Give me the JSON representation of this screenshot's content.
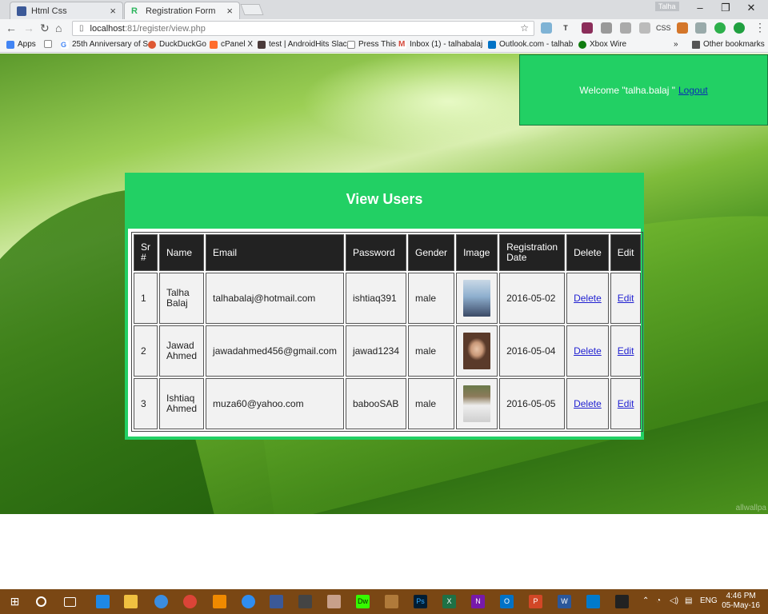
{
  "browser": {
    "tabs": [
      {
        "label": "Html Css",
        "favicon": "facebook-icon",
        "active": false
      },
      {
        "label": "Registration Form",
        "favicon": "r-favicon-icon",
        "active": true
      }
    ],
    "profile_name": "Talha",
    "url_host": "localhost",
    "url_path": ":81/register/view.php",
    "bookmarks": [
      {
        "label": "Apps",
        "icon": "apps-icon"
      },
      {
        "label": "",
        "icon": "document-icon"
      },
      {
        "label": "25th Anniversary of S",
        "icon": "google-icon"
      },
      {
        "label": "DuckDuckGo",
        "icon": "duckduckgo-icon"
      },
      {
        "label": "cPanel X",
        "icon": "cpanel-icon"
      },
      {
        "label": "test | AndroidHits Slac",
        "icon": "slack-icon"
      },
      {
        "label": "Press This",
        "icon": "document-icon"
      },
      {
        "label": "Inbox (1) - talhabalaj",
        "icon": "gmail-icon"
      },
      {
        "label": "Outlook.com - talhab",
        "icon": "outlook-icon"
      },
      {
        "label": "Xbox Wire",
        "icon": "xbox-icon"
      }
    ],
    "other_bookmarks": "Other bookmarks",
    "overflow": "»",
    "ext_css_label": "CSS"
  },
  "page": {
    "welcome_text": "Welcome \"talha.balaj \"",
    "logout_label": "Logout",
    "title": "View Users",
    "watermark": "allwallpa",
    "columns": [
      "Sr #",
      "Name",
      "Email",
      "Password",
      "Gender",
      "Image",
      "Registration Date",
      "Delete",
      "Edit"
    ],
    "rows": [
      {
        "sr": "1",
        "name": "Talha Balaj",
        "email": "talhabalaj@hotmail.com",
        "password": "ishtiaq391",
        "gender": "male",
        "date": "2016-05-02",
        "delete": "Delete",
        "edit": "Edit"
      },
      {
        "sr": "2",
        "name": "Jawad Ahmed",
        "email": "jawadahmed456@gmail.com",
        "password": "jawad1234",
        "gender": "male",
        "date": "2016-05-04",
        "delete": "Delete",
        "edit": "Edit"
      },
      {
        "sr": "3",
        "name": "Ishtiaq Ahmed",
        "email": "muza60@yahoo.com",
        "password": "babooSAB",
        "gender": "male",
        "date": "2016-05-05",
        "delete": "Delete",
        "edit": "Edit"
      }
    ]
  },
  "taskbar": {
    "language": "ENG",
    "time": "4:46 PM",
    "date": "05-May-16",
    "apps": [
      "windows-icon",
      "search-icon",
      "task-view-icon",
      "edge-icon",
      "file-explorer-icon",
      "ie-icon",
      "chrome-icon",
      "vlc-icon",
      "messenger-icon",
      "facebook-icon",
      "store-icon",
      "paint-icon",
      "dreamweaver-icon",
      "archive-icon",
      "photoshop-icon",
      "excel-icon",
      "onenote-icon",
      "outlook-icon",
      "powerpoint-icon",
      "word-icon",
      "visual-studio-icon",
      "terminal-icon"
    ]
  },
  "colors": {
    "panel_green": "#22d064",
    "table_header": "#222222",
    "taskbar": "#7a4714",
    "link": "#1f1fd1"
  }
}
